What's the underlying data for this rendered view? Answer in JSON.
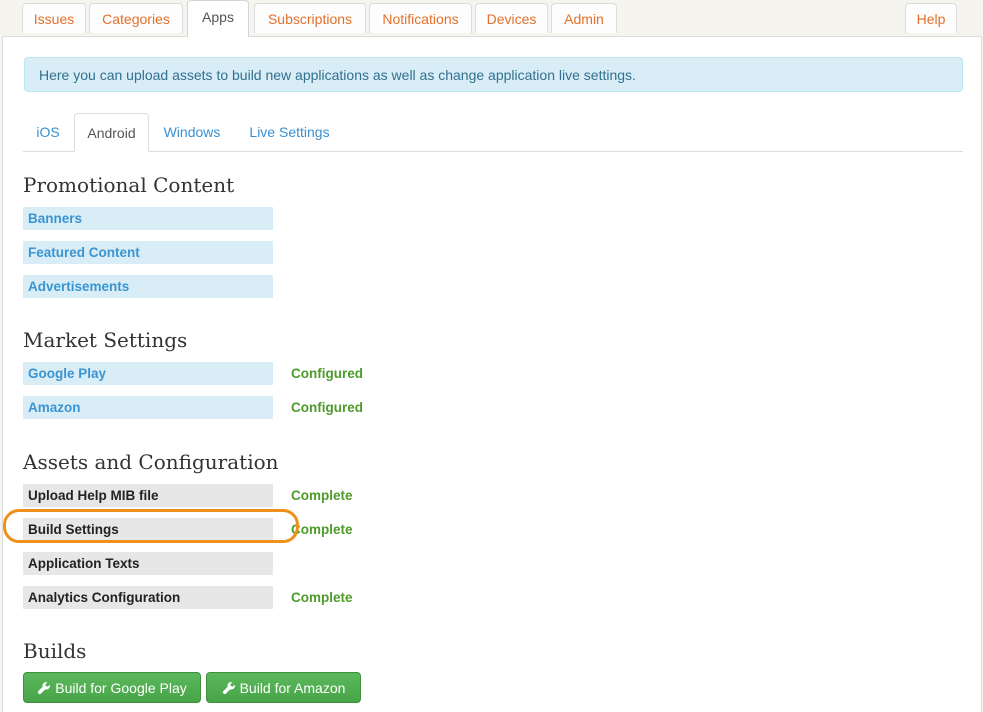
{
  "top_tabs": [
    "Issues",
    "Categories",
    "Apps",
    "Subscriptions",
    "Notifications",
    "Devices",
    "Admin"
  ],
  "help_label": "Help",
  "active_top_tab": "Apps",
  "info_text": "Here you can upload assets to build new applications as well as change application live settings.",
  "sub_tabs": [
    "iOS",
    "Android",
    "Windows",
    "Live Settings"
  ],
  "active_sub_tab": "Android",
  "promotional": {
    "heading": "Promotional Content",
    "items": [
      "Banners",
      "Featured Content",
      "Advertisements"
    ]
  },
  "market": {
    "heading": "Market Settings",
    "items": [
      {
        "label": "Google Play",
        "status": "Configured"
      },
      {
        "label": "Amazon",
        "status": "Configured"
      }
    ]
  },
  "assets": {
    "heading": "Assets and Configuration",
    "items": [
      {
        "label": "Upload Help MIB file",
        "status": "Complete"
      },
      {
        "label": "Build Settings",
        "status": "Complete"
      },
      {
        "label": "Application Texts",
        "status": ""
      },
      {
        "label": "Analytics Configuration",
        "status": "Complete"
      }
    ]
  },
  "builds": {
    "heading": "Builds",
    "buttons": [
      "Build for Google Play",
      "Build for Amazon"
    ]
  },
  "icons": {
    "build_button_icon": "wrench-icon"
  },
  "colors": {
    "accent_orange": "#e2702a",
    "link_blue": "#3a95d1",
    "status_green": "#4e9a2a",
    "button_green": "#5cb85c",
    "highlight_orange": "#f0901c"
  }
}
